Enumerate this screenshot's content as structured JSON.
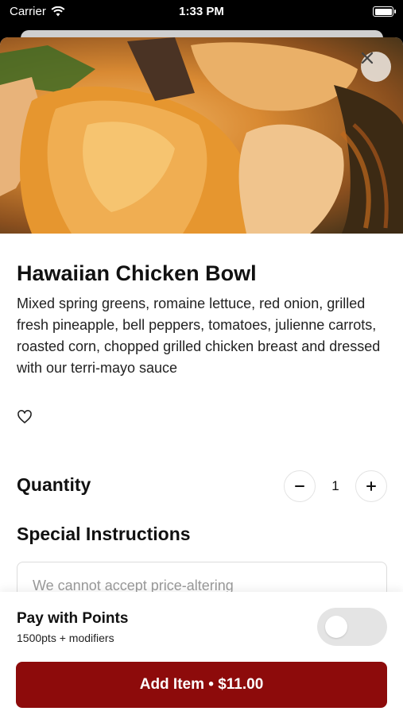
{
  "status_bar": {
    "carrier": "Carrier",
    "time": "1:33 PM"
  },
  "item": {
    "title": "Hawaiian Chicken Bowl",
    "description": "Mixed spring greens, romaine lettuce, red onion, grilled fresh pineapple, bell peppers, tomatoes, julienne carrots, roasted corn, chopped grilled chicken breast and dressed with our terri-mayo sauce"
  },
  "quantity": {
    "label": "Quantity",
    "value": "1"
  },
  "special_instructions": {
    "label": "Special Instructions",
    "placeholder": "We cannot accept price-altering"
  },
  "points": {
    "title": "Pay with Points",
    "subtitle": "1500pts + modifiers",
    "enabled": false
  },
  "add_button": {
    "label": "Add Item • $11.00"
  },
  "colors": {
    "accent": "#8d0b0b",
    "toggle_off": "#e4e4e4"
  },
  "icons": {
    "close": "close-icon",
    "favorite": "heart-outline-icon",
    "minus": "minus-icon",
    "plus": "plus-icon",
    "wifi": "wifi-icon",
    "battery": "battery-icon"
  }
}
